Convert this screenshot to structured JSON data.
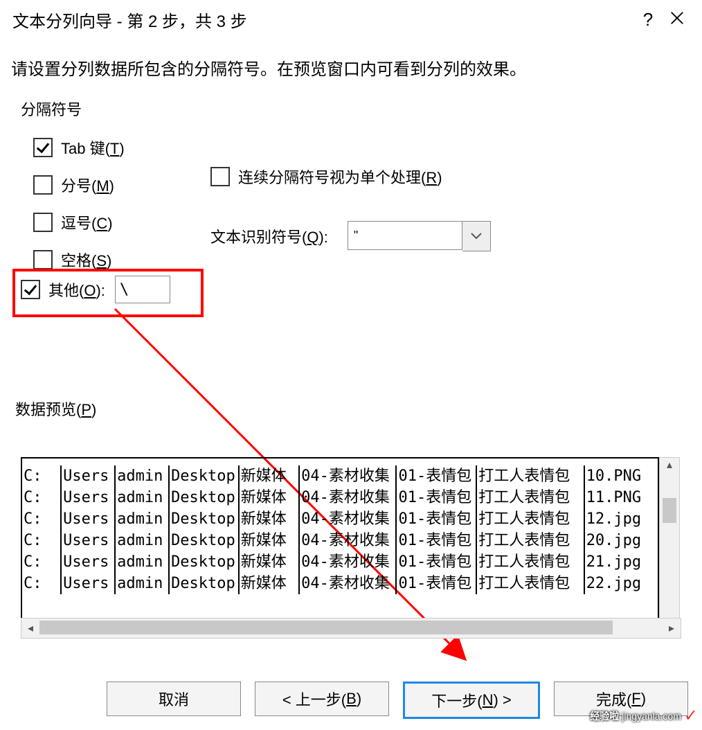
{
  "title": "文本分列向导 - 第 2 步，共 3 步",
  "help_icon": "?",
  "instruction": "请设置分列数据所包含的分隔符号。在预览窗口内可看到分列的效果。",
  "group_legend": "分隔符号",
  "delims": {
    "tab": {
      "label_pre": "Tab 键(",
      "hot": "T",
      "label_post": ")",
      "checked": true
    },
    "semi": {
      "label_pre": "分号(",
      "hot": "M",
      "label_post": ")",
      "checked": false
    },
    "comma": {
      "label_pre": "逗号(",
      "hot": "C",
      "label_post": ")",
      "checked": false
    },
    "space": {
      "label_pre": "空格(",
      "hot": "S",
      "label_post": ")",
      "checked": false
    },
    "other": {
      "label_pre": "其他(",
      "hot": "O",
      "label_post": "):",
      "checked": true,
      "value": "\\"
    }
  },
  "consecutive": {
    "label_pre": "连续分隔符号视为单个处理(",
    "hot": "R",
    "label_post": ")",
    "checked": false
  },
  "textqual": {
    "label_pre": "文本识别符号(",
    "hot": "Q",
    "label_post": "):",
    "value": "\""
  },
  "preview_label_pre": "数据预览(",
  "preview_hot": "P",
  "preview_label_post": ")",
  "preview_rows": [
    [
      "C:",
      "Users",
      "admin",
      "Desktop",
      "新媒体",
      "04-素材收集",
      "01-表情包",
      "打工人表情包",
      "10.PNG"
    ],
    [
      "C:",
      "Users",
      "admin",
      "Desktop",
      "新媒体",
      "04-素材收集",
      "01-表情包",
      "打工人表情包",
      "11.PNG"
    ],
    [
      "C:",
      "Users",
      "admin",
      "Desktop",
      "新媒体",
      "04-素材收集",
      "01-表情包",
      "打工人表情包",
      "12.jpg"
    ],
    [
      "C:",
      "Users",
      "admin",
      "Desktop",
      "新媒体",
      "04-素材收集",
      "01-表情包",
      "打工人表情包",
      "20.jpg"
    ],
    [
      "C:",
      "Users",
      "admin",
      "Desktop",
      "新媒体",
      "04-素材收集",
      "01-表情包",
      "打工人表情包",
      "21.jpg"
    ],
    [
      "C:",
      "Users",
      "admin",
      "Desktop",
      "新媒体",
      "04-素材收集",
      "01-表情包",
      "打工人表情包",
      "22.jpg"
    ]
  ],
  "buttons": {
    "cancel": "取消",
    "back_pre": "< 上一步(",
    "back_hot": "B",
    "back_post": ")",
    "next_pre": "下一步(",
    "next_hot": "N",
    "next_post": ") >",
    "finish_pre": "完成(",
    "finish_hot": "F",
    "finish_post": ")"
  },
  "watermark": {
    "text1": "经验啦",
    "text2": "jingyanla.com"
  }
}
